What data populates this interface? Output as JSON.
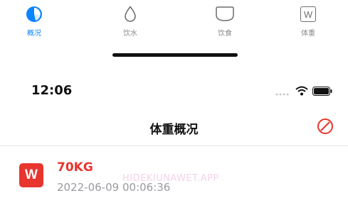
{
  "tabbar": {
    "tabs": [
      {
        "label": "概况",
        "icon": "pie-chart-icon",
        "active": true
      },
      {
        "label": "饮水",
        "icon": "water-drop-icon",
        "active": false
      },
      {
        "label": "饮食",
        "icon": "plate-icon",
        "active": false
      },
      {
        "label": "体重",
        "icon": "weight-w-icon",
        "active": false
      }
    ],
    "weight_icon_letter": "W"
  },
  "statusbar": {
    "time": "12:06"
  },
  "navbar": {
    "title": "体重概况",
    "action_icon": "prohibit-icon"
  },
  "record": {
    "icon_letter": "W",
    "weight": "70KG",
    "date": "2022-06-09 00:06:36",
    "watermark": "HIDEKIUNAWET.APP"
  },
  "colors": {
    "accent": "#0a84ff",
    "danger": "#e8352e",
    "inactive": "#8a8a8e",
    "date_text": "#9a9aa0"
  }
}
